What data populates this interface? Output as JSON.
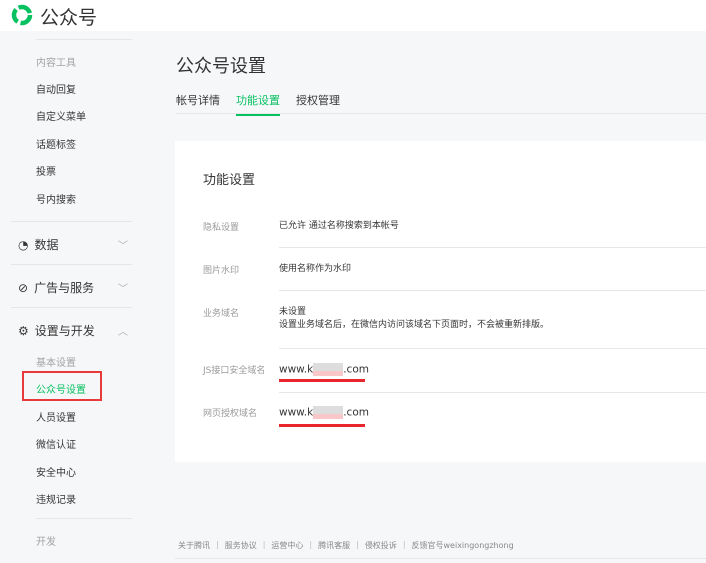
{
  "header": {
    "brand": "公众号"
  },
  "sidebar": {
    "content_tools": {
      "label": "内容工具",
      "items": [
        "自动回复",
        "自定义菜单",
        "话题标签",
        "投票",
        "号内搜索"
      ]
    },
    "groups": [
      {
        "label": "数据",
        "icon": "pie-chart-icon"
      },
      {
        "label": "广告与服务",
        "icon": "compass-icon"
      },
      {
        "label": "设置与开发",
        "icon": "gear-icon"
      }
    ],
    "settings": {
      "label": "基本设置",
      "items": [
        "公众号设置",
        "人员设置",
        "微信认证",
        "安全中心",
        "违规记录"
      ]
    },
    "dev": {
      "label": "开发"
    }
  },
  "main": {
    "title": "公众号设置",
    "tabs": [
      "帐号详情",
      "功能设置",
      "授权管理"
    ],
    "card_title": "功能设置",
    "rows": [
      {
        "label": "隐私设置",
        "value": "已允许 通过名称搜索到本帐号"
      },
      {
        "label": "图片水印",
        "value": "使用名称作为水印"
      },
      {
        "label": "业务域名",
        "value": "未设置",
        "note": "设置业务域名后，在微信内访问该域名下页面时，不会被重新排版。"
      },
      {
        "label": "JS接口安全域名",
        "value_prefix": "www.k",
        "value_suffix": ".com"
      },
      {
        "label": "网页授权域名",
        "value_prefix": "www.k",
        "value_suffix": ".com"
      }
    ]
  },
  "footer": [
    "关于腾讯",
    "服务协议",
    "运营中心",
    "腾讯客服",
    "侵权投诉",
    "反馈官号weixingongzhong"
  ],
  "colors": {
    "accent": "#07c160",
    "highlight": "#e83a3a"
  }
}
